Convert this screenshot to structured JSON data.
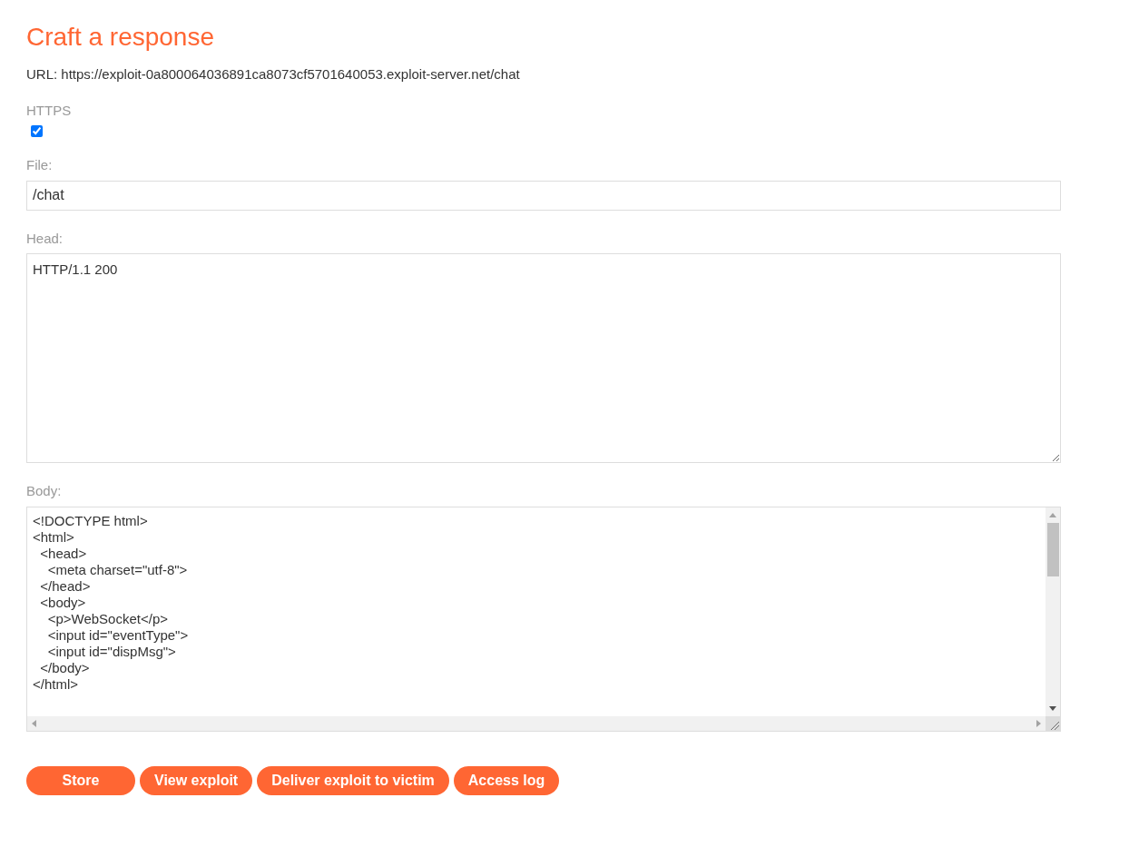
{
  "title": "Craft a response",
  "url": "URL: https://exploit-0a800064036891ca8073cf5701640053.exploit-server.net/chat",
  "https": {
    "label": "HTTPS",
    "checked": true
  },
  "file": {
    "label": "File:",
    "value": "/chat"
  },
  "head": {
    "label": "Head:",
    "value": "HTTP/1.1 200"
  },
  "body": {
    "label": "Body:",
    "lines": [
      "<!DOCTYPE html>",
      "<html>",
      "  <head>",
      "    <meta charset=\"utf-8\">",
      "  </head>",
      "  <body>",
      "    <p>WebSocket</p>",
      "    <input id=\"eventType\">",
      "    <input id=\"dispMsg\">",
      "  </body>",
      "</html>"
    ]
  },
  "buttons": [
    "Store",
    "View exploit",
    "Deliver exploit to victim",
    "Access log"
  ]
}
